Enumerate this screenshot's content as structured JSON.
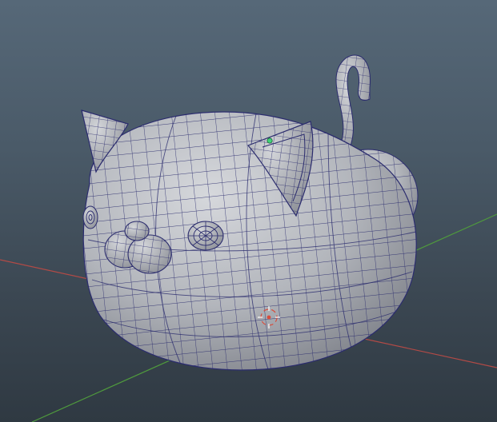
{
  "viewport": {
    "background_top": "#566878",
    "background_bottom": "#2f3942",
    "grid_x_axis_color": "#b24a46",
    "grid_z_axis_color": "#4f9a3d",
    "wireframe_color": "#2b2c6e",
    "surface_color": "#b9bcc2",
    "selected_vertex_color": "#3fd47a",
    "manipulator_color": "#d84c3c"
  },
  "model": {
    "name_icon": "cat-model-icon",
    "parts": [
      "body",
      "head",
      "left-ear",
      "right-ear",
      "left-eye",
      "right-eye",
      "muzzle",
      "tail",
      "back"
    ]
  },
  "manipulator": {
    "icon": "pivot-crosshair-icon"
  }
}
